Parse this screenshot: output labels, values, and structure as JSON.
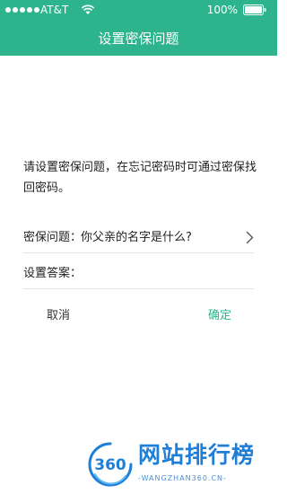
{
  "status_bar": {
    "carrier": "AT&T",
    "battery": "100%"
  },
  "nav": {
    "title": "设置密保问题"
  },
  "description": "请设置密保问题，在忘记密码时可通过密保找回密码。",
  "question": {
    "label": "密保问题：",
    "value": "你父亲的名字是什么?"
  },
  "answer": {
    "label": "设置答案：",
    "value": "",
    "placeholder": ""
  },
  "actions": {
    "cancel_label": "取消",
    "confirm_label": "确定"
  },
  "watermark": {
    "logo_text": "360",
    "title": "网站排行榜",
    "url": "-WANGZHAN360.CN-"
  },
  "colors": {
    "accent": "#2db48c",
    "watermark": "#1f7fd8"
  },
  "icons": {
    "wifi": "wifi-icon",
    "battery": "battery-icon",
    "chevron": "chevron-right-icon"
  }
}
